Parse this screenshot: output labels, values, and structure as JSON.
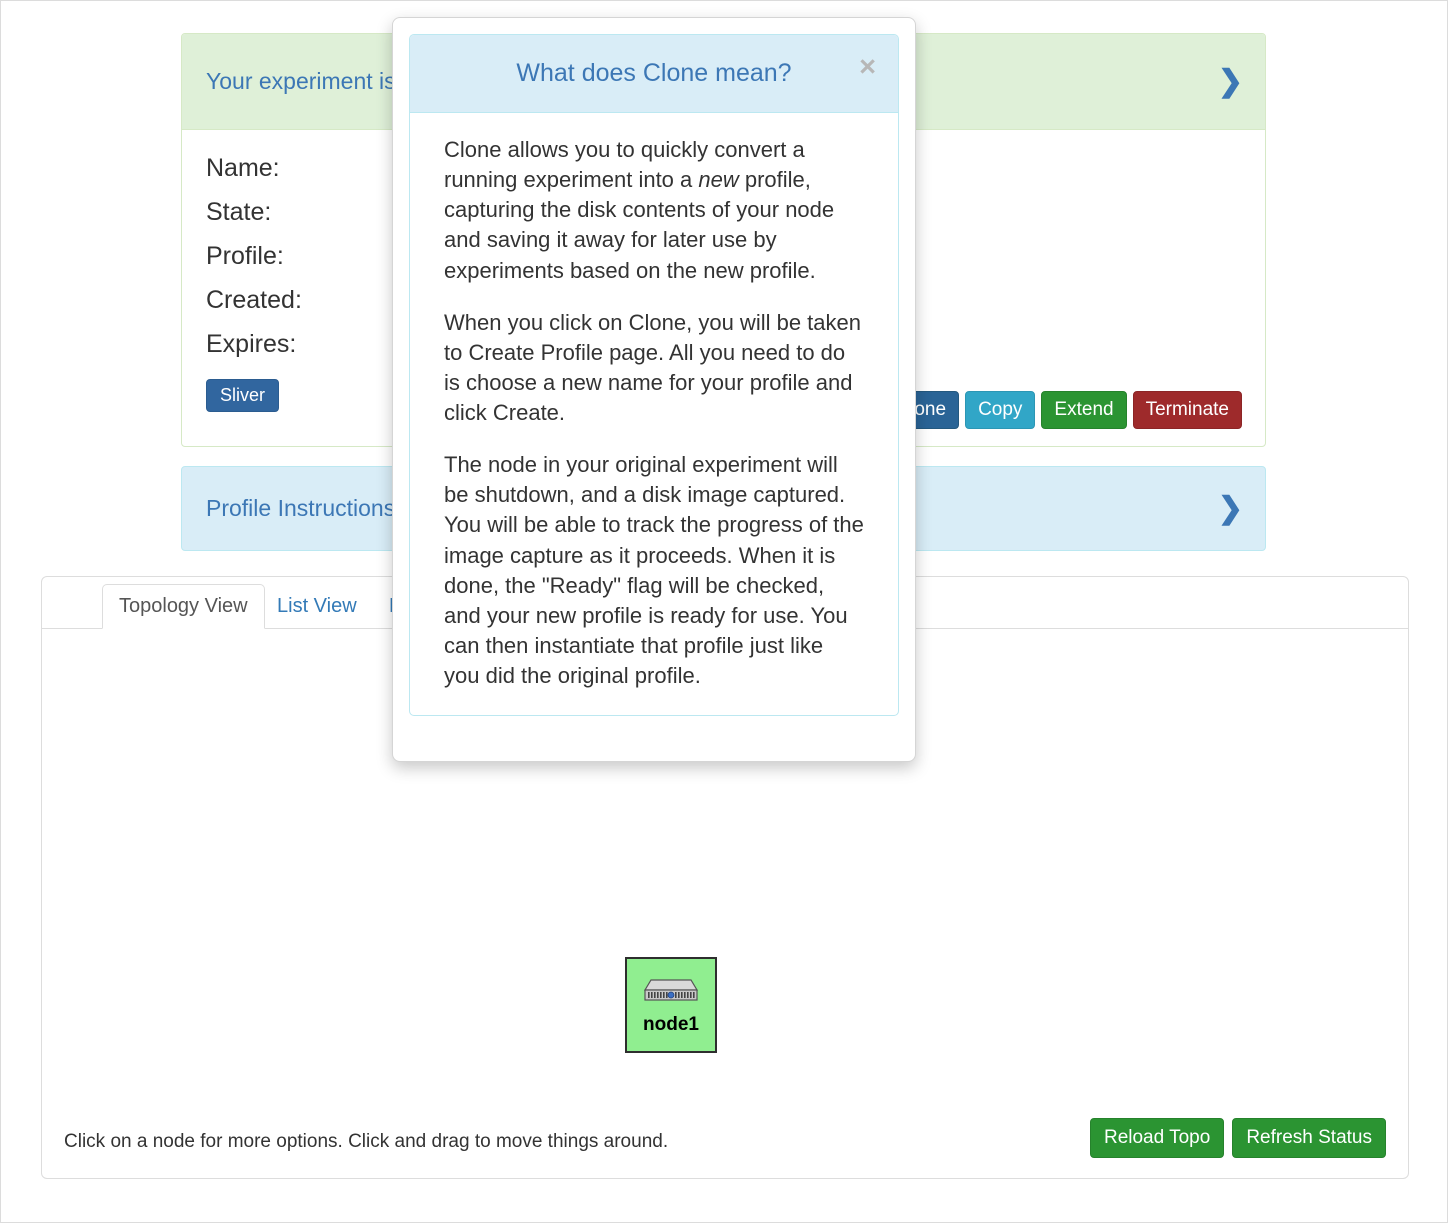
{
  "status_panel": {
    "title": "Your experiment is ready!",
    "chevron_icon": "chevron-right-icon",
    "fields": [
      {
        "label": "Name:"
      },
      {
        "label": "State:"
      },
      {
        "label": "Profile:"
      },
      {
        "label": "Created:"
      },
      {
        "label": "Expires:"
      }
    ],
    "sliver_label": "Sliver",
    "actions": [
      {
        "label": "Clone",
        "color": "#2a6496"
      },
      {
        "label": "Copy",
        "color": "#31a6c7"
      },
      {
        "label": "Extend",
        "color": "#2b9432"
      },
      {
        "label": "Terminate",
        "color": "#9e2a2b"
      }
    ]
  },
  "instructions_panel": {
    "title": "Profile Instructions",
    "chevron_icon": "chevron-right-icon"
  },
  "topology_panel": {
    "tabs": [
      {
        "label": "Topology View",
        "active": true
      },
      {
        "label": "List View",
        "active": false
      },
      {
        "label": "Manifest",
        "active": false
      }
    ],
    "node": {
      "label": "node1",
      "icon": "server-node-icon",
      "color": "#90ee90"
    },
    "hint": "Click on a node for more options. Click and drag to move things around.",
    "buttons": [
      {
        "label": "Reload Topo"
      },
      {
        "label": "Refresh Status"
      }
    ]
  },
  "modal": {
    "title": "What does Clone mean?",
    "close_icon": "close-icon",
    "close_label": "×",
    "paragraph1_a": "Clone allows you to quickly convert a running experiment into a ",
    "paragraph1_em": "new",
    "paragraph1_b": " profile, capturing the disk contents of your node and saving it away for later use by experiments based on the new profile.",
    "paragraph2": "When you click on Clone, you will be taken to Create Profile page. All you need to do is choose a new name for your profile and click Create.",
    "paragraph3": "The node in your original experiment will be shutdown, and a disk image captured. You will be able to track the progress of the image capture as it proceeds. When it is done, the \"Ready\" flag will be checked, and your new profile is ready for use. You can then instantiate that profile just like you did the original profile."
  },
  "colors": {
    "success_bg": "#dff0d8",
    "info_bg": "#d9edf7",
    "link": "#337ab7",
    "heading_text": "#3c77b5"
  }
}
